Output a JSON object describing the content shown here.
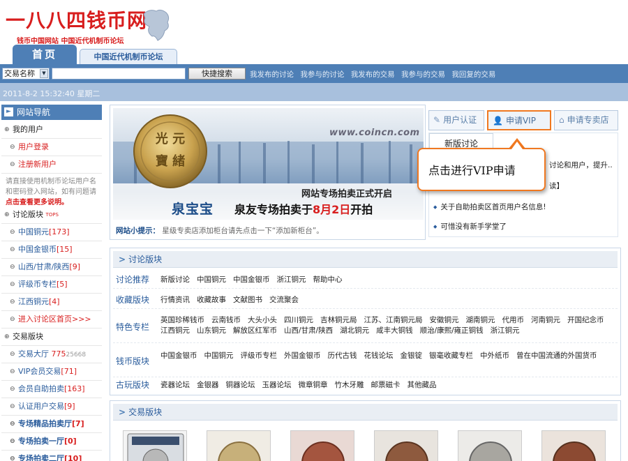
{
  "header": {
    "logo_title": "一八八四钱币网",
    "logo_subtitle": "钱币中国网站 中国近代机制币论坛",
    "tabs": [
      "首页",
      "中国近代机制币论坛"
    ]
  },
  "search": {
    "select_value": "交易名称",
    "input_value": "",
    "button_label": "快捷搜索",
    "quick_links": [
      "我发布的讨论",
      "我参与的讨论",
      "我发布的交易",
      "我参与的交易",
      "我回复的交易"
    ]
  },
  "date_text": "2011-8-2 15:32:40 星期二",
  "sidebar": {
    "nav_title": "网站导航",
    "my_user": "我的用户",
    "login": "用户登录",
    "register": "注册新用户",
    "note_prefix": "请直接使用机制币论坛用户名和密码登入网站，如有问题请",
    "note_link": "点击查看更多说明。",
    "forum_group": "讨论版块",
    "forum_group_tag": "TOPS",
    "forum_items": [
      {
        "label": "中国铜元",
        "count": "[173]"
      },
      {
        "label": "中国金银币",
        "count": "[15]"
      },
      {
        "label": "山西/甘肃/陕西",
        "count": "[9]"
      },
      {
        "label": "评级币专栏",
        "count": "[5]"
      },
      {
        "label": "江西铜元",
        "count": "[4]"
      }
    ],
    "enter_forum": "进入讨论区首页>>>",
    "trade_group": "交易版块",
    "trade_items": [
      {
        "label": "交易大厅",
        "count": "775",
        "extra": "25668"
      },
      {
        "label": "VIP会员交易",
        "count": "[71]",
        "extra": ""
      },
      {
        "label": "会员自助拍卖",
        "count": "[163]",
        "extra": ""
      },
      {
        "label": "认证用户交易",
        "count": "[9]",
        "extra": ""
      },
      {
        "label": "专场精品拍卖厅",
        "count": "[7]",
        "extra": ""
      },
      {
        "label": "专场拍卖一厅",
        "count": "[0]",
        "extra": ""
      },
      {
        "label": "专场拍卖二厅",
        "count": "[10]",
        "extra": ""
      }
    ]
  },
  "banner": {
    "url": "www.coincn.com",
    "line1": "网站专场拍卖正式开启",
    "brand": "泉宝宝",
    "line2_prefix": "泉友专场拍卖于",
    "line2_date": "8月2日",
    "line2_suffix": "开拍",
    "tip_label": "网站小提示：",
    "tip_text": "星级专卖店添加柜台请先点击一下“添加新柜台”。"
  },
  "right": {
    "btn_auth": "用户认证",
    "btn_vip": "申请VIP",
    "btn_shop": "申请专卖店",
    "tab_label": "新版讨论",
    "frag1": "讨论和用户，提升..",
    "frag2": "读】",
    "items": [
      "关于自助拍卖区首页用户名信息!",
      "可惜没有新手学堂了"
    ]
  },
  "callout_text": "点击进行VIP申请",
  "discussion": {
    "title": "讨论版块",
    "rows": [
      {
        "label": "讨论推荐",
        "items": [
          "新版讨论",
          "中国铜元",
          "中国金银币",
          "浙江铜元",
          "帮助中心"
        ]
      },
      {
        "label": "收藏版块",
        "items": [
          "行情资讯",
          "收藏故事",
          "文献图书",
          "交流聚会"
        ]
      },
      {
        "label": "特色专栏",
        "items": [
          "英国珍稀钱币",
          "云南钱币",
          "大头小头",
          "四川铜元",
          "吉林铜元局",
          "江苏、江南铜元局",
          "安徽铜元",
          "湖南铜元",
          "代用币",
          "河南铜元",
          "开国纪念币",
          "江西铜元",
          "山东铜元",
          "解放区红军币",
          "山西/甘肃/陕西",
          "湖北铜元",
          "咸丰大铜钱",
          "顺治/康熙/雍正铜钱",
          "浙江铜元"
        ]
      },
      {
        "label": "钱币版块",
        "items": [
          "中国金银币",
          "中国铜元",
          "评级币专栏",
          "外国金银币",
          "历代古钱",
          "花钱论坛",
          "金银锭",
          "银毫收藏专栏",
          "中外纸币",
          "曾在中国流通的外国货币"
        ]
      },
      {
        "label": "古玩版块",
        "items": [
          "瓷器论坛",
          "金银器",
          "铜器论坛",
          "玉器论坛",
          "微章铜章",
          "竹木牙雕",
          "邮票磁卡",
          "其他藏品"
        ]
      }
    ]
  },
  "trade": {
    "title": "交易版块"
  },
  "colors": {
    "brand_red": "#d81e1e",
    "nav_blue": "#4e7fb6",
    "link_blue": "#2a5c9c",
    "callout_orange": "#f07820"
  }
}
